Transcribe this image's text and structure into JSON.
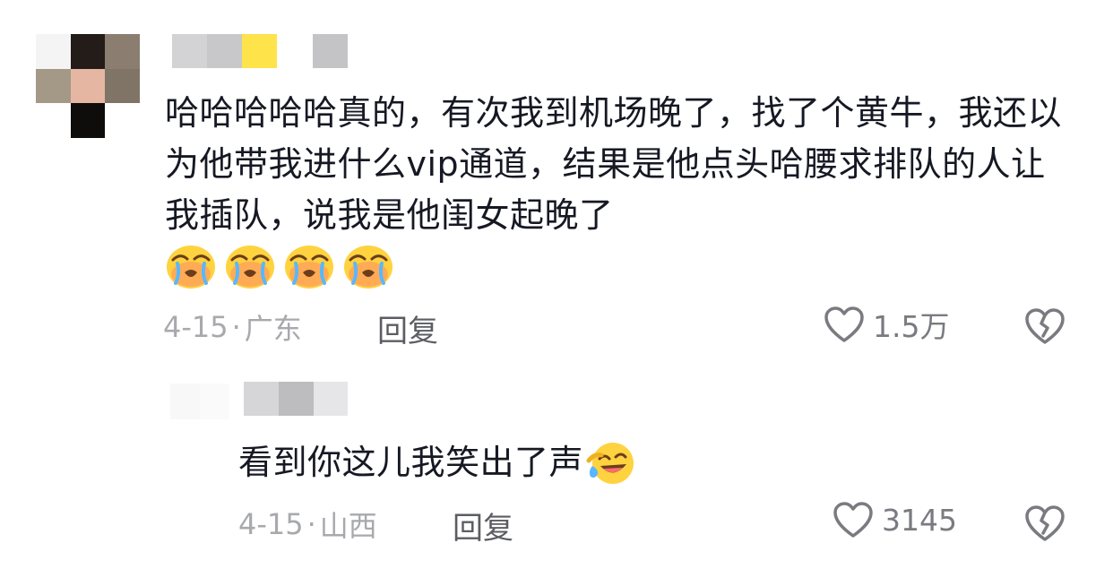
{
  "comment": {
    "text": "哈哈哈哈哈真的，有次我到机场晚了，找了个黄牛，我还以为他带我进什么vip通道，结果是他点头哈腰求排队的人让我插队，说我是他闺女起晚了",
    "emoji_icons": [
      "crying-face-icon",
      "crying-face-icon",
      "crying-face-icon",
      "crying-face-icon"
    ],
    "date": "4-15",
    "dot": "·",
    "location": "广东",
    "reply_label": "回复",
    "like_count": "1.5万"
  },
  "reply": {
    "text": "看到你这儿我笑出了声",
    "emoji_icon": "laughing-tears-icon",
    "date": "4-15",
    "dot": "·",
    "location": "山西",
    "reply_label": "回复",
    "like_count": "3145"
  },
  "colors": {
    "text": "#161823",
    "meta": "#a8a9ad",
    "reply_button": "#5c5d63",
    "like": "#7a7b80",
    "emoji_yellow": "#ffd23f"
  }
}
